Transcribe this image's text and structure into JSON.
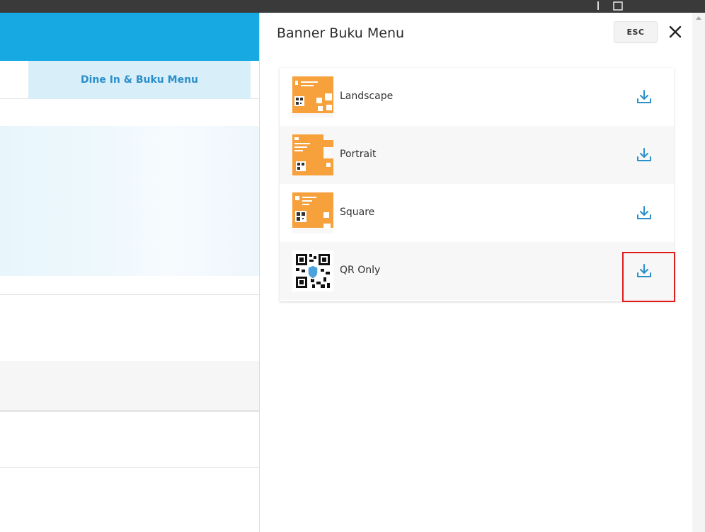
{
  "panel": {
    "title": "Banner Buku Menu",
    "esc_label": "ESC",
    "items": [
      {
        "label": "Landscape"
      },
      {
        "label": "Portrait"
      },
      {
        "label": "Square"
      },
      {
        "label": "QR Only"
      }
    ]
  },
  "background_page": {
    "active_tab": "Dine In & Buku Menu"
  },
  "colors": {
    "header_blue": "#17a9e1",
    "tab_active_bg": "#d8eef9",
    "tab_active_text": "#2b8fc9",
    "download_icon": "#2b8fc9",
    "thumb_orange": "#f7a13c",
    "highlight_red": "#e01b1b"
  },
  "icons": {
    "download": "download-icon",
    "close": "close-icon"
  }
}
